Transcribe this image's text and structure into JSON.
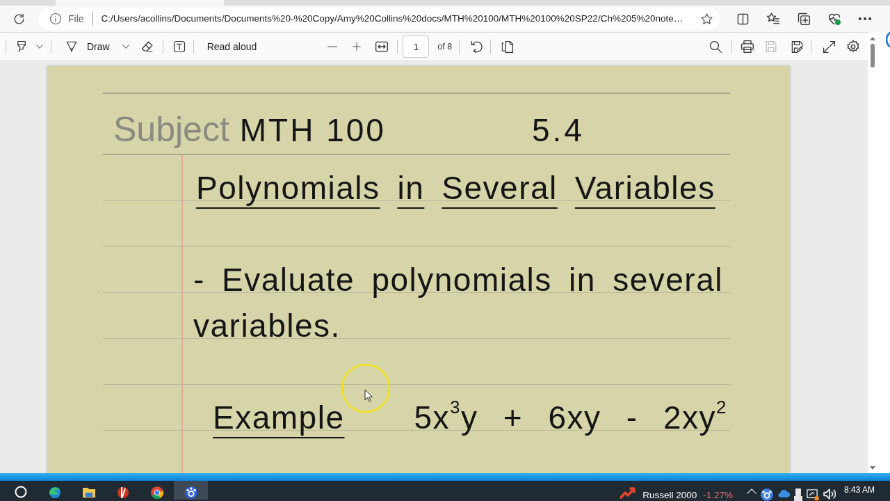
{
  "browser": {
    "address_bar": {
      "scheme": "File",
      "url": "C:/Users/acollins/Documents/Documents%20-%20Copy/Amy%20Collins%20docs/MTH%20100/MTH%20100%20SP22/Ch%205%20note…"
    }
  },
  "pdf_toolbar": {
    "draw_label": "Draw",
    "read_aloud_label": "Read aloud",
    "page_number": "1",
    "page_count": "of 8",
    "save_disabled": true
  },
  "page": {
    "subject_label": "Subject",
    "course": "MTH 100",
    "section": "5.4",
    "title_words": [
      {
        "text": "Polynomials",
        "underlined": true
      },
      {
        "text": "in",
        "underlined": true
      },
      {
        "text": "Several",
        "underlined": true
      },
      {
        "text": "Variables",
        "underlined": true
      }
    ],
    "objective": "- Evaluate polynomials in several variables.",
    "example": {
      "label": "Example",
      "underlined": true,
      "expression": "5x$^{3}$y + 6xy - 2xy$^{2}$"
    }
  },
  "taskbar": {
    "apps": [
      {
        "selected": false
      },
      {
        "selected": false
      },
      {
        "selected": false
      },
      {
        "selected": false
      },
      {
        "selected": true
      }
    ],
    "ticker": {
      "name": "Russell 2000",
      "change": "-1.27%"
    },
    "clock": "8:43 AM"
  }
}
